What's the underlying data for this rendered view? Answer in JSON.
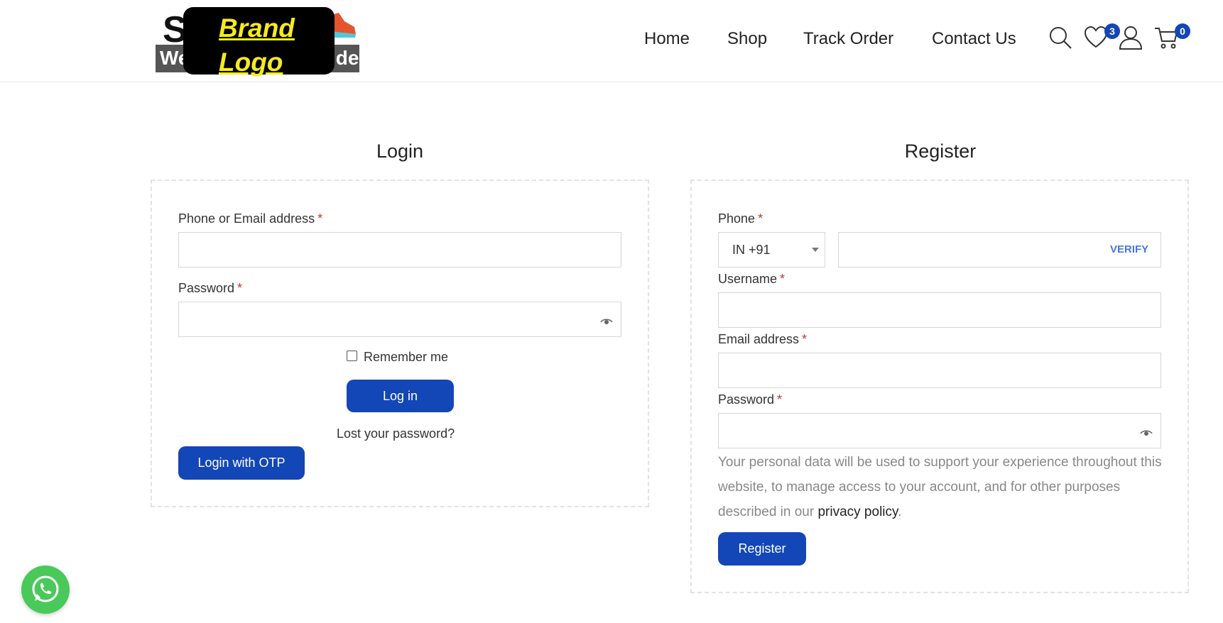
{
  "header": {
    "brand": {
      "logo_text_top": "S",
      "logo_text_left": "We",
      "logo_text_right": "ide",
      "placeholder_line1": "Brand",
      "placeholder_line2": "Logo"
    },
    "nav": [
      {
        "label": "Home"
      },
      {
        "label": "Shop"
      },
      {
        "label": "Track Order"
      },
      {
        "label": "Contact Us"
      }
    ],
    "icons": {
      "search": "search-icon",
      "wishlist": "heart-icon",
      "account": "user-icon",
      "cart": "cart-icon"
    },
    "wishlist_count": "3",
    "cart_count": "0",
    "accent_color": "#1346b6"
  },
  "login": {
    "title": "Login",
    "identifier_label": "Phone or Email address",
    "identifier_value": "",
    "password_label": "Password",
    "password_value": "",
    "required_marker": "*",
    "remember_label": "Remember me",
    "remember_checked": false,
    "submit_label": "Log in",
    "lost_password_label": "Lost your password?",
    "otp_label": "Login with OTP"
  },
  "register": {
    "title": "Register",
    "phone_label": "Phone",
    "country_code": "IN +91",
    "phone_value": "",
    "verify_label": "VERIFY",
    "username_label": "Username",
    "username_value": "",
    "email_label": "Email address",
    "email_value": "",
    "password_label": "Password",
    "password_value": "",
    "required_marker": "*",
    "notice_text": "Your personal data will be used to support your experience throughout this website, to manage access to your account, and for other purposes described in our ",
    "privacy_link": "privacy policy",
    "notice_end": ".",
    "submit_label": "Register"
  },
  "floating": {
    "whatsapp_icon": "whatsapp-icon",
    "whatsapp_color": "#49c95a"
  }
}
